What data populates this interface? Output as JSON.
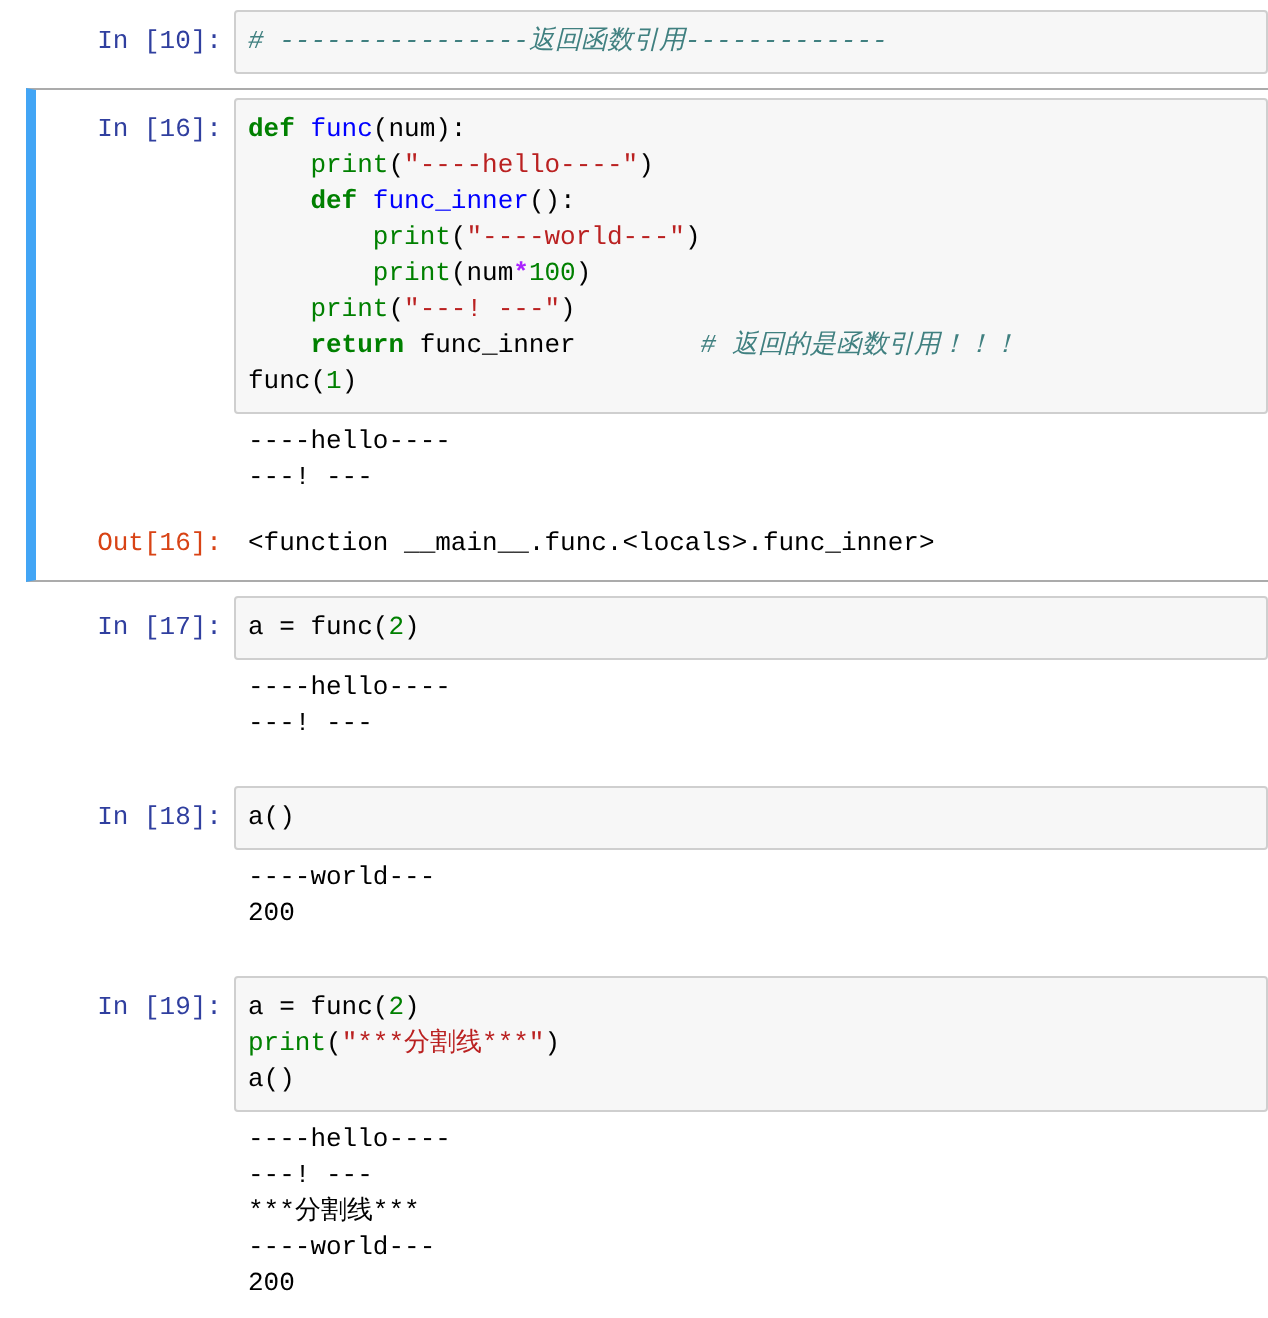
{
  "cells": [
    {
      "prompt": "In [10]:",
      "selected": false,
      "code": [
        [
          {
            "t": "# ----------------返回函数引用-------------",
            "kind": "comment"
          }
        ]
      ]
    },
    {
      "prompt": "In [16]:",
      "selected": true,
      "code": [
        [
          {
            "t": "def",
            "kind": "keyword"
          },
          {
            "t": " func",
            "kind": "function"
          },
          {
            "t": "(num):",
            "kind": "plain"
          }
        ],
        [
          {
            "t": "    print",
            "kind": "builtin"
          },
          {
            "t": "(",
            "kind": "plain"
          },
          {
            "t": "\"----hello----\"",
            "kind": "string"
          },
          {
            "t": ")",
            "kind": "plain"
          }
        ],
        [
          {
            "t": "    def",
            "kind": "keyword"
          },
          {
            "t": " func_inner",
            "kind": "function"
          },
          {
            "t": "():",
            "kind": "plain"
          }
        ],
        [
          {
            "t": "        print",
            "kind": "builtin"
          },
          {
            "t": "(",
            "kind": "plain"
          },
          {
            "t": "\"----world---\"",
            "kind": "string"
          },
          {
            "t": ")",
            "kind": "plain"
          }
        ],
        [
          {
            "t": "        print",
            "kind": "builtin"
          },
          {
            "t": "(num",
            "kind": "plain"
          },
          {
            "t": "*",
            "kind": "operator"
          },
          {
            "t": "100",
            "kind": "number"
          },
          {
            "t": ")",
            "kind": "plain"
          }
        ],
        [
          {
            "t": "    print",
            "kind": "builtin"
          },
          {
            "t": "(",
            "kind": "plain"
          },
          {
            "t": "\"---! ---\"",
            "kind": "string"
          },
          {
            "t": ")",
            "kind": "plain"
          }
        ],
        [
          {
            "t": "    return",
            "kind": "keyword"
          },
          {
            "t": " func_inner        ",
            "kind": "plain"
          },
          {
            "t": "# 返回的是函数引用！！！",
            "kind": "comment"
          }
        ],
        [
          {
            "t": "func(",
            "kind": "plain"
          },
          {
            "t": "1",
            "kind": "number"
          },
          {
            "t": ")",
            "kind": "plain"
          }
        ]
      ],
      "outputs": [
        {
          "kind": "stream",
          "lines": [
            "----hello----",
            "---! ---"
          ]
        },
        {
          "kind": "result",
          "prompt": "Out[16]:",
          "text": "<function __main__.func.<locals>.func_inner>"
        }
      ]
    },
    {
      "prompt": "In [17]:",
      "selected": false,
      "code": [
        [
          {
            "t": "a = func(",
            "kind": "plain"
          },
          {
            "t": "2",
            "kind": "number"
          },
          {
            "t": ")",
            "kind": "plain"
          }
        ]
      ],
      "outputs": [
        {
          "kind": "stream",
          "lines": [
            "----hello----",
            "---! ---"
          ]
        }
      ]
    },
    {
      "prompt": "In [18]:",
      "selected": false,
      "code": [
        [
          {
            "t": "a()",
            "kind": "plain"
          }
        ]
      ],
      "outputs": [
        {
          "kind": "stream",
          "lines": [
            "----world---",
            "200"
          ]
        }
      ]
    },
    {
      "prompt": "In [19]:",
      "selected": false,
      "code": [
        [
          {
            "t": "a = func(",
            "kind": "plain"
          },
          {
            "t": "2",
            "kind": "number"
          },
          {
            "t": ")",
            "kind": "plain"
          }
        ],
        [
          {
            "t": "print",
            "kind": "builtin"
          },
          {
            "t": "(",
            "kind": "plain"
          },
          {
            "t": "\"***分割线***\"",
            "kind": "string"
          },
          {
            "t": ")",
            "kind": "plain"
          }
        ],
        [
          {
            "t": "a()",
            "kind": "plain"
          }
        ]
      ],
      "outputs": [
        {
          "kind": "stream",
          "lines": [
            "----hello----",
            "---! ---",
            "***分割线***",
            "----world---",
            "200"
          ]
        }
      ]
    }
  ]
}
